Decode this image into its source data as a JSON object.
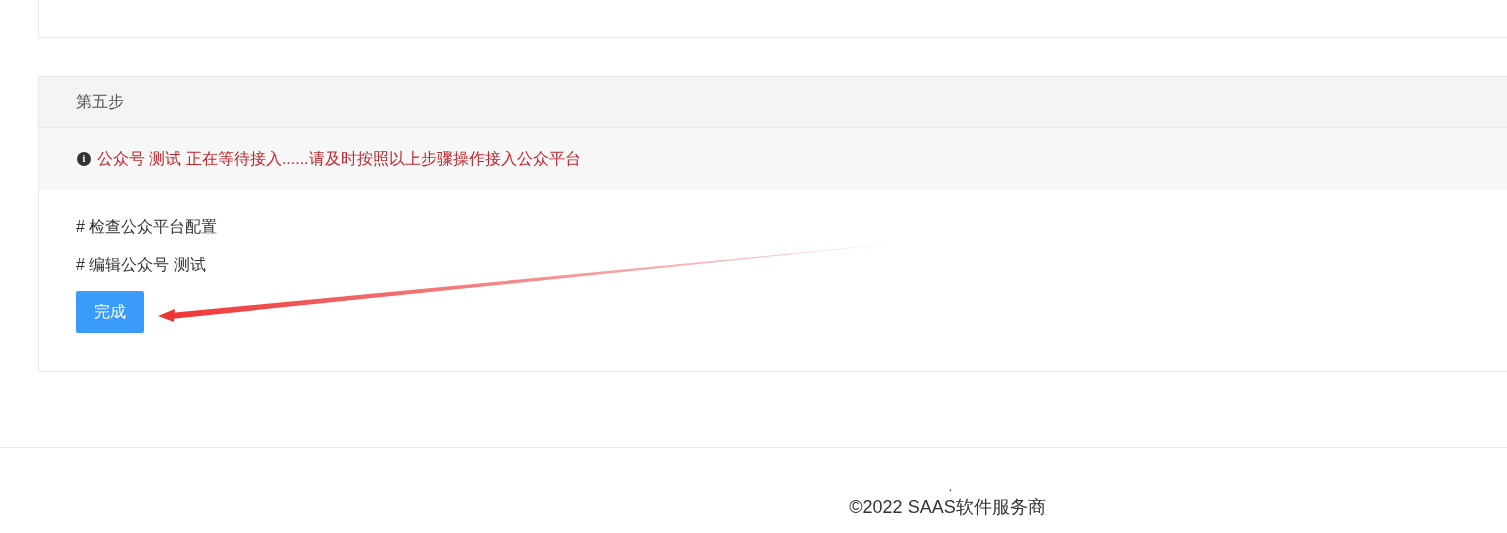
{
  "step": {
    "title": "第五步",
    "alert": {
      "icon": "i",
      "text": "公众号 测试 正在等待接入......请及时按照以上步骤操作接入公众平台"
    },
    "links": [
      "# 检查公众平台配置",
      "# 编辑公众号 测试"
    ],
    "button": "完成"
  },
  "footer": {
    "dot": ".",
    "copyright": "©2022 SAAS软件服务商"
  }
}
